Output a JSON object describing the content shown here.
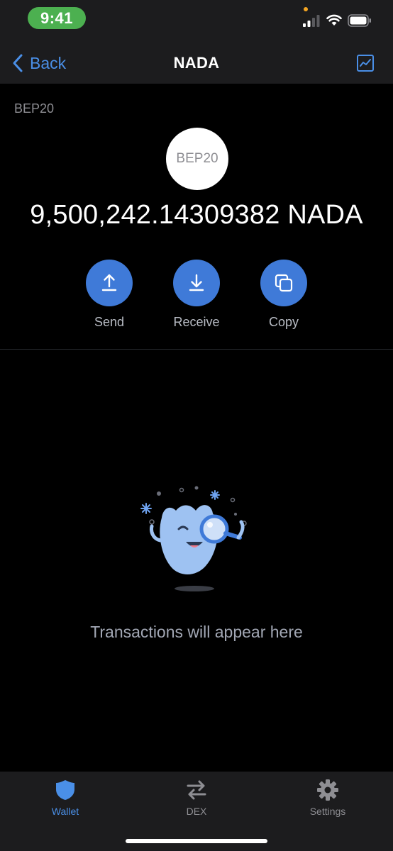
{
  "status_bar": {
    "time": "9:41"
  },
  "nav": {
    "back_label": "Back",
    "title": "NADA"
  },
  "token": {
    "network": "BEP20",
    "logo_text": "BEP20",
    "balance": "9,500,242.14309382 NADA"
  },
  "actions": [
    {
      "label": "Send",
      "icon": "upload-icon"
    },
    {
      "label": "Receive",
      "icon": "download-icon"
    },
    {
      "label": "Copy",
      "icon": "copy-icon"
    }
  ],
  "empty_state": {
    "message": "Transactions will appear here"
  },
  "tabs": [
    {
      "label": "Wallet",
      "icon": "shield-icon",
      "active": true
    },
    {
      "label": "DEX",
      "icon": "swap-arrows-icon",
      "active": false
    },
    {
      "label": "Settings",
      "icon": "gear-icon",
      "active": false
    }
  ],
  "colors": {
    "accent": "#4a8fe7",
    "action_button": "#3f7ad8",
    "time_pill": "#4cb050",
    "bar_background": "#1c1c1e"
  }
}
